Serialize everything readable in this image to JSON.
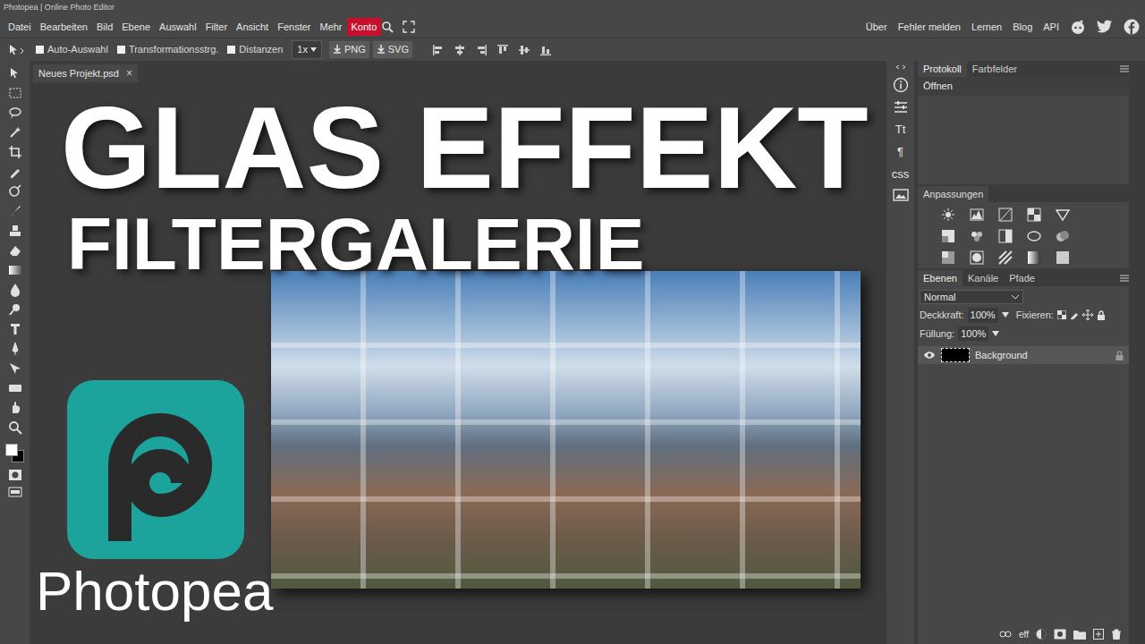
{
  "window": {
    "title": "Photopea | Online Photo Editor"
  },
  "menu": {
    "items": [
      "Datei",
      "Bearbeiten",
      "Bild",
      "Ebene",
      "Auswahl",
      "Filter",
      "Ansicht",
      "Fenster",
      "Mehr"
    ],
    "account": "Konto"
  },
  "links": [
    "Über",
    "Fehler melden",
    "Lernen",
    "Blog",
    "API"
  ],
  "options": {
    "checkboxes": [
      {
        "label": "Auto-Auswahl",
        "checked": false
      },
      {
        "label": "Transformationsstrg.",
        "checked": false
      },
      {
        "label": "Distanzen",
        "checked": false
      }
    ],
    "zoom": "1x",
    "export": [
      "PNG",
      "SVG"
    ]
  },
  "document_tabs": [
    {
      "label": "Neues Projekt.psd",
      "close": "×",
      "selected": true
    }
  ],
  "side_icons": {
    "text": [
      "Tt",
      "¶",
      "css"
    ]
  },
  "history_panel": {
    "tabs": [
      {
        "label": "Protokoll",
        "selected": true
      },
      {
        "label": "Farbfelder",
        "selected": false
      }
    ],
    "items": [
      "Öffnen"
    ]
  },
  "adjustments": {
    "title": "Anpassungen"
  },
  "layers_panel": {
    "tabs": [
      {
        "label": "Ebenen",
        "selected": true
      },
      {
        "label": "Kanäle",
        "selected": false
      },
      {
        "label": "Pfade",
        "selected": false
      }
    ],
    "blend_mode": "Normal",
    "opacity_label": "Deckkraft:",
    "opacity": "100%",
    "lock_label": "Fixieren:",
    "fill_label": "Füllung:",
    "fill": "100%",
    "layers": [
      {
        "name": "Background",
        "visible": true,
        "selected": true,
        "locked": true
      }
    ],
    "footer": [
      "eff"
    ]
  },
  "overlay": {
    "title": "GLAS EFFEKT",
    "subtitle": "FILTERGALERIE",
    "brand": "Photopea"
  }
}
